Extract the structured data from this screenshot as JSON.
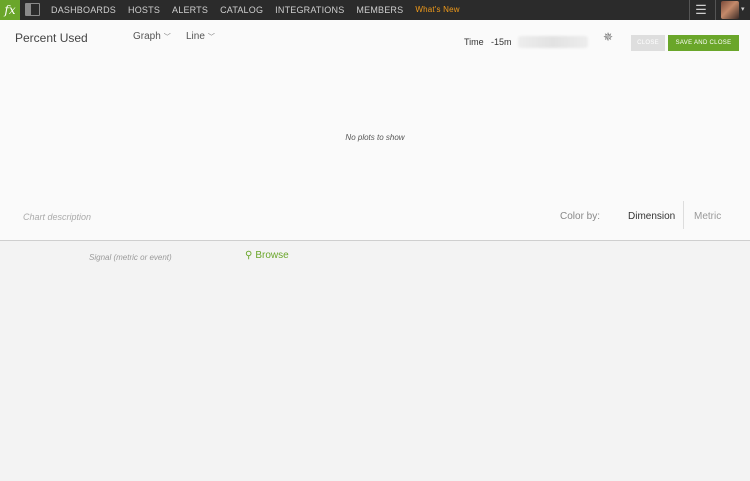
{
  "nav": {
    "logo": "fx",
    "items": [
      "DASHBOARDS",
      "HOSTS",
      "ALERTS",
      "CATALOG",
      "INTEGRATIONS",
      "MEMBERS"
    ],
    "whats_new": "What's New"
  },
  "header": {
    "title": "Percent Used",
    "chart_kind": "Graph",
    "plot_type": "Line",
    "time_label": "Time",
    "time_value": "-15m",
    "close_label": "CLOSE",
    "save_label": "SAVE AND CLOSE"
  },
  "chart": {
    "empty_message": "No plots to show",
    "description_placeholder": "Chart description"
  },
  "color_by": {
    "label": "Color by:",
    "options": [
      "Dimension",
      "Metric"
    ],
    "selected": "Dimension"
  },
  "signal": {
    "placeholder": "Signal (metric or event)",
    "browse_label": "Browse"
  },
  "colors": {
    "accent": "#6aa62a",
    "nav_bg": "#2b2b2b",
    "whats_new": "#f09a1a"
  }
}
